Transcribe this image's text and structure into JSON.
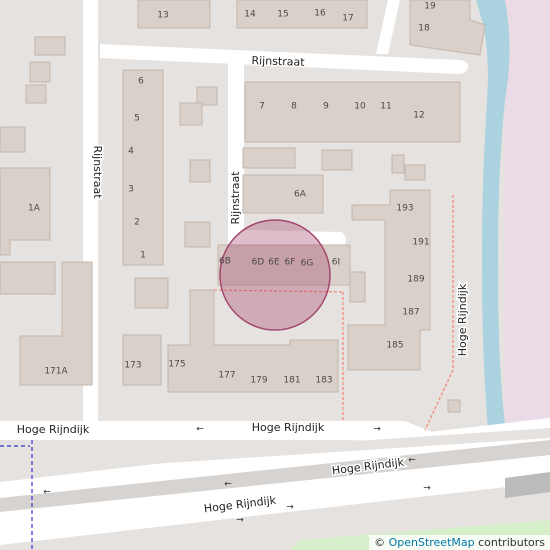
{
  "map": {
    "streets": {
      "rijnstraat_h": "Rijnstraat",
      "rijnstraat_left": "Rijnstraat",
      "rijnstraat_mid": "Rijnstraat",
      "hoge_rijndijk_1": "Hoge Rijndijk",
      "hoge_rijndijk_2": "Hoge Rijndijk",
      "hoge_rijndijk_3": "Hoge Rijndijk",
      "hoge_rijndijk_4": "Hoge Rijndijk",
      "hoge_rijndijk_vertical": "Hoge Rijndijk"
    },
    "house_numbers": {
      "n13": "13",
      "n14": "14",
      "n15": "15",
      "n16": "16",
      "n17": "17",
      "n18": "18",
      "n19": "19",
      "n6": "6",
      "n5": "5",
      "n4": "4",
      "n3": "3",
      "n2": "2",
      "n1": "1",
      "n1a": "1A",
      "n7": "7",
      "n8": "8",
      "n9": "9",
      "n10": "10",
      "n11": "11",
      "n12": "12",
      "n6a": "6A",
      "n6b": "6B",
      "n6d": "6D",
      "n6e": "6E",
      "n6f": "6F",
      "n6g": "6G",
      "n6i": "6I",
      "n193": "193",
      "n191": "191",
      "n189": "189",
      "n187": "187",
      "n185": "185",
      "n173": "173",
      "n175": "175",
      "n177": "177",
      "n179": "179",
      "n181": "181",
      "n183": "183",
      "n171a": "171A"
    },
    "one_way_arrows": {
      "left": "←",
      "right": "→"
    },
    "marker": {
      "type": "circle-highlight",
      "color": "#a3466e"
    },
    "colors": {
      "background": "#e5e2df",
      "building": "#d9d0c9",
      "water": "#aad3df",
      "road": "#ffffff",
      "grass": "#d6eec9",
      "path": "#fa8072",
      "boundary": "#3333cc"
    }
  },
  "attribution": {
    "copyright_symbol": "©",
    "link_text": "OpenStreetMap",
    "suffix": " contributors"
  }
}
